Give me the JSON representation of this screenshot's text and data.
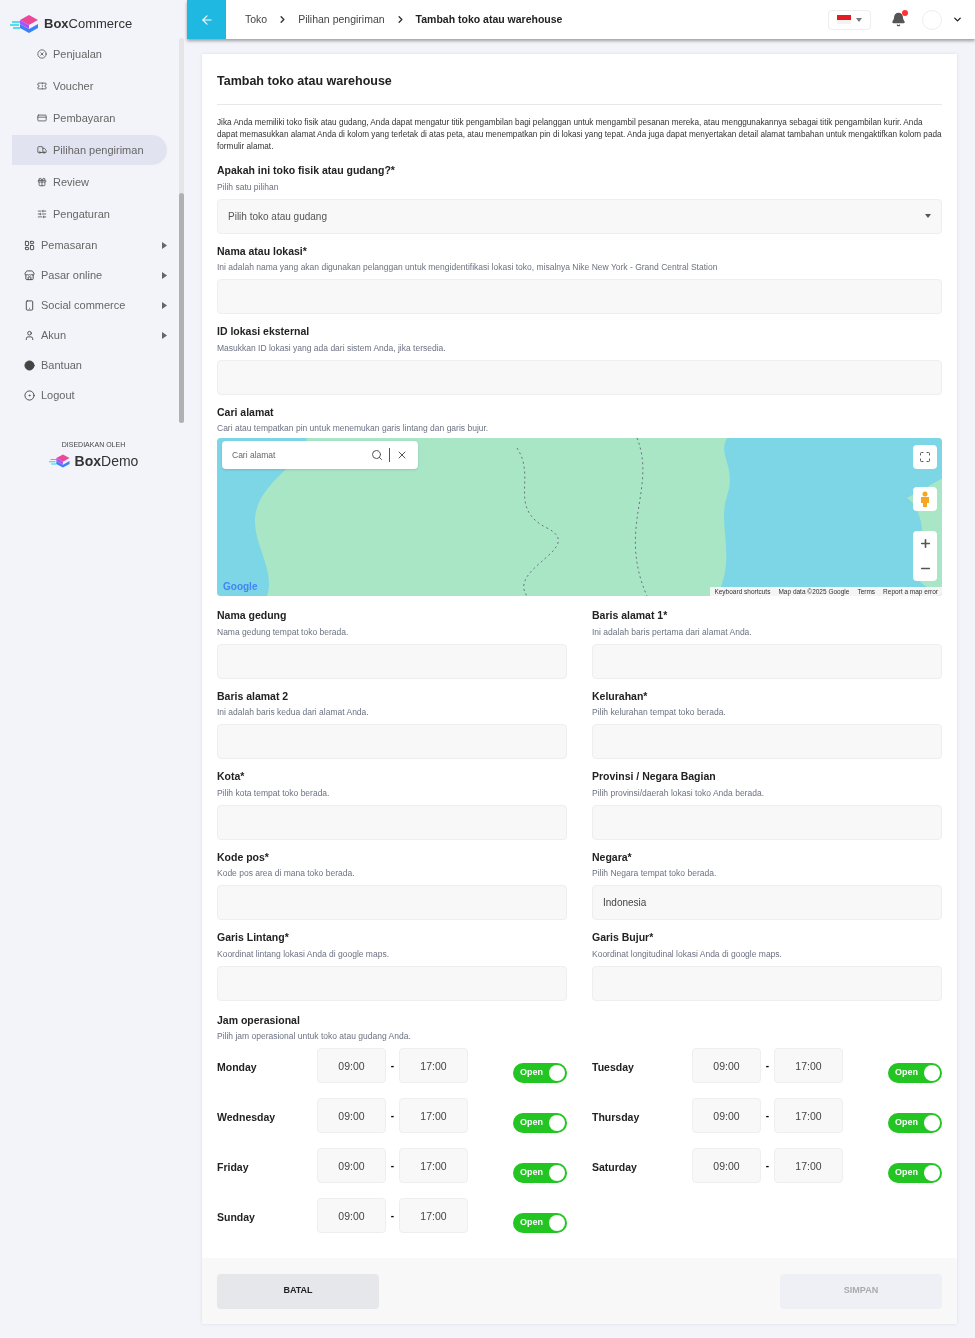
{
  "sidebar": {
    "brand": {
      "bold": "Box",
      "rest": "Commerce"
    },
    "sub_items": [
      {
        "label": "Penjualan",
        "selected": false
      },
      {
        "label": "Voucher",
        "selected": false
      },
      {
        "label": "Pembayaran",
        "selected": false
      },
      {
        "label": "Pilihan pengiriman",
        "selected": true
      },
      {
        "label": "Review",
        "selected": false
      },
      {
        "label": "Pengaturan",
        "selected": false
      }
    ],
    "items": [
      {
        "label": "Pemasaran",
        "expandable": true
      },
      {
        "label": "Pasar online",
        "expandable": true
      },
      {
        "label": "Social commerce",
        "expandable": true
      },
      {
        "label": "Akun",
        "expandable": true
      },
      {
        "label": "Bantuan",
        "expandable": false
      },
      {
        "label": "Logout",
        "expandable": false
      }
    ],
    "footer": {
      "caption": "DISEDIAKAN OLEH",
      "bold": "Box",
      "rest": "Demo"
    }
  },
  "header": {
    "breadcrumbs": [
      "Toko",
      "Pilihan pengiriman",
      "Tambah toko atau warehouse"
    ],
    "has_notification": true
  },
  "form": {
    "title": "Tambah toko atau warehouse",
    "intro": "Jika Anda memiliki toko fisik atau gudang, Anda dapat mengatur titik pengambilan bagi pelanggan untuk mengambil pesanan mereka, atau menggunakannya sebagai titik pengambilan kurir. Anda dapat memasukkan alamat Anda di kolom yang terletak di atas peta, atau menempatkan pin di lokasi yang tepat. Anda juga dapat menyertakan detail alamat tambahan untuk mengaktifkan kolom pada formulir alamat.",
    "type_field": {
      "label": "Apakah ini toko fisik atau gudang?*",
      "hint": "Pilih satu pilihan",
      "placeholder": "Pilih toko atau gudang"
    },
    "full_fields": [
      {
        "label": "Nama atau lokasi*",
        "hint": "Ini adalah nama yang akan digunakan pelanggan untuk mengidentifikasi lokasi toko, misalnya Nike New York - Grand Central Station"
      },
      {
        "label": "ID lokasi eksternal",
        "hint": "Masukkan ID lokasi yang ada dari sistem Anda, jika tersedia."
      }
    ],
    "address_search": {
      "label": "Cari alamat",
      "hint": "Cari atau tempatkan pin untuk menemukan garis lintang dan garis bujur.",
      "search_placeholder": "Cari alamat",
      "map_logo": "Google",
      "attribution": [
        "Keyboard shortcuts",
        "Map data ©2025 Google",
        "Terms",
        "Report a map error"
      ]
    },
    "address_fields": [
      {
        "label": "Nama gedung",
        "hint": "Nama gedung tempat toko berada."
      },
      {
        "label": "Baris alamat 1*",
        "hint": "Ini adalah baris pertama dari alamat Anda."
      },
      {
        "label": "Baris alamat 2",
        "hint": "Ini adalah baris kedua dari alamat Anda."
      },
      {
        "label": "Kelurahan*",
        "hint": "Pilih kelurahan tempat toko berada."
      },
      {
        "label": "Kota*",
        "hint": "Pilih kota tempat toko berada."
      },
      {
        "label": "Provinsi / Negara Bagian",
        "hint": "Pilih provinsi/daerah lokasi toko Anda berada."
      },
      {
        "label": "Kode pos*",
        "hint": "Kode pos area di mana toko berada."
      },
      {
        "label": "Negara*",
        "hint": "Pilih Negara tempat toko berada.",
        "value": "Indonesia"
      },
      {
        "label": "Garis Lintang*",
        "hint": "Koordinat lintang lokasi Anda di google maps."
      },
      {
        "label": "Garis Bujur*",
        "hint": "Koordinat longitudinal lokasi Anda di google maps."
      }
    ],
    "hours": {
      "label": "Jam operasional",
      "hint": "Pilih jam operasional untuk toko atau gudang Anda.",
      "days": [
        {
          "day": "Monday",
          "from": "09:00",
          "separator": "-",
          "to": "17:00",
          "toggle": "Open",
          "open": true
        },
        {
          "day": "Tuesday",
          "from": "09:00",
          "separator": "-",
          "to": "17:00",
          "toggle": "Open",
          "open": true
        },
        {
          "day": "Wednesday",
          "from": "09:00",
          "separator": "-",
          "to": "17:00",
          "toggle": "Open",
          "open": true
        },
        {
          "day": "Thursday",
          "from": "09:00",
          "separator": "-",
          "to": "17:00",
          "toggle": "Open",
          "open": true
        },
        {
          "day": "Friday",
          "from": "09:00",
          "separator": "-",
          "to": "17:00",
          "toggle": "Open",
          "open": true
        },
        {
          "day": "Saturday",
          "from": "09:00",
          "separator": "-",
          "to": "17:00",
          "toggle": "Open",
          "open": true
        },
        {
          "day": "Sunday",
          "from": "09:00",
          "separator": "-",
          "to": "17:00",
          "toggle": "Open",
          "open": true
        }
      ]
    },
    "actions": {
      "cancel": "BATAL",
      "save": "SIMPAN",
      "save_disabled": true
    }
  }
}
